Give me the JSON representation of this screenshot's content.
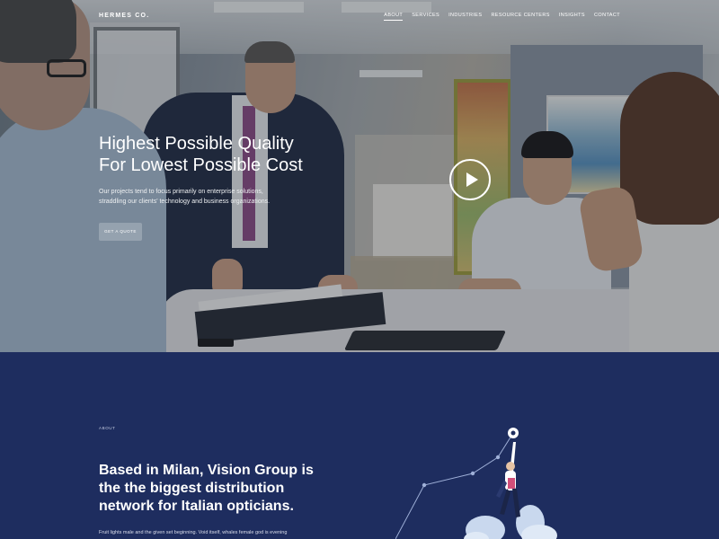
{
  "brand": {
    "logo_text": "HERMES CO."
  },
  "nav": {
    "items": [
      {
        "label": "ABOUT",
        "active": true
      },
      {
        "label": "SERVICES",
        "active": false
      },
      {
        "label": "INDUSTRIES",
        "active": false
      },
      {
        "label": "RESOURCE CENTERS",
        "active": false
      },
      {
        "label": "INSIGHTS",
        "active": false
      },
      {
        "label": "CONTACT",
        "active": false
      }
    ]
  },
  "hero": {
    "title_line1": "Highest Possible Quality",
    "title_line2": "For Lowest Possible Cost",
    "subtitle": "Our projects tend to focus primarily on enterprise solutions, straddling our clients' technology and business organizations.",
    "cta_label": "GET A QUOTE",
    "play_icon": "play-icon"
  },
  "about": {
    "label": "ABOUT",
    "heading": "Based in Milan, Vision Group is the the biggest distribution network for Italian opticians.",
    "body": "Fruit lights male and the given set beginning. Void itself, whales female god is evening"
  },
  "colors": {
    "about_bg": "#1e2d5f",
    "text_white": "#ffffff",
    "accent_pink": "#d14f7a"
  }
}
